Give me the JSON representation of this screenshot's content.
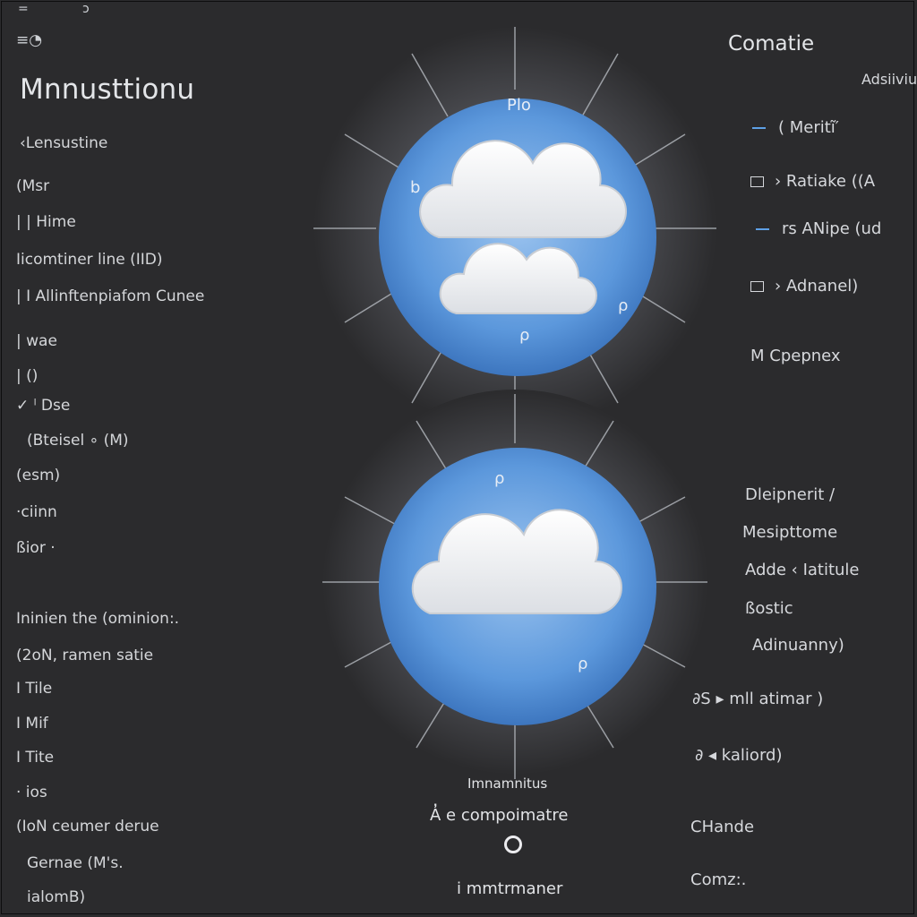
{
  "top_marks": [
    "=",
    "ↄ"
  ],
  "app_icons_label": "≡◔",
  "left_panel": {
    "title": "Mnnusttionu",
    "items": [
      "‹Lensustine",
      "(Msr",
      "| |  Hime",
      "Iicomtiner line  (IID)",
      "|  I  Allinftenpiafom Cunee",
      "|  wae",
      "|  ()",
      "✓  ˡ Dse",
      "(Bteisel  ∘  (M)",
      "(esm)",
      "·ciinn",
      "ßior ·",
      "Ininien  the (ominion:.",
      "(2oN,    ramen    satie",
      "I Tile",
      "I Mif",
      "I Tite",
      "· ios",
      "(IoN    ceumer  derue",
      "Gernae             (M's.",
      "ialomB)"
    ]
  },
  "orb_top": {
    "label": "Plo"
  },
  "center_bottom": {
    "label1": "Imnamnitus",
    "label2": "A̓ e compoimatre",
    "label3": "i mmtrmaner"
  },
  "right_panel": {
    "title": "Comatie",
    "subtitle": "Adsiiviu",
    "rows_top": [
      {
        "mark": "dash",
        "text": "(   Meritĩ′"
      },
      {
        "mark": "box",
        "text": "›   Ratiake  ((A"
      },
      {
        "mark": "dash",
        "text": "rs    ANipe   (ud"
      },
      {
        "mark": "box",
        "text": "›     Adnanel)"
      }
    ],
    "single": "M   Cpepnex",
    "rows_mid": [
      "Dleipnerit /",
      "Mesipttome",
      "Adde ‹ Iatitule",
      "ßostic",
      "Adinuanny)"
    ],
    "row_mil": "∂S ▸    mll   atimar )",
    "row_kal": "∂ ◂     kaliord)",
    "bottom": [
      "CHande",
      "Comz:."
    ]
  },
  "colors": {
    "background": "#2b2b2d",
    "accent_blue": "#5ea0e6",
    "orb_blue": "#4f8ed6"
  }
}
